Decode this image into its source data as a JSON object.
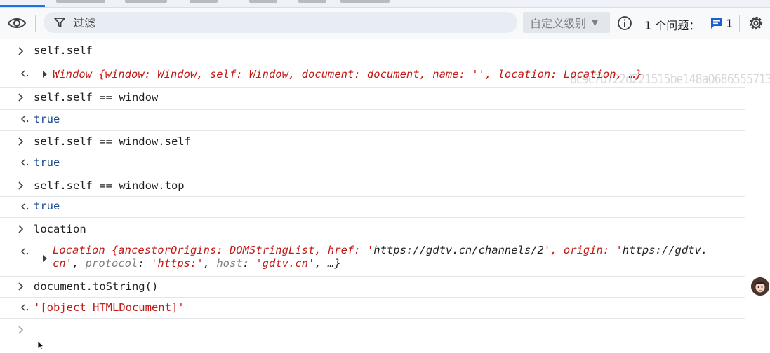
{
  "toolbar": {
    "filter_placeholder": "过滤",
    "levels_label": "自定义级别",
    "issues_label": "1 个问题：",
    "issues_count": "1"
  },
  "watermark": "8c9c7b722d221515be148a0686555713",
  "console": {
    "entries": [
      {
        "kind": "input",
        "text": "self.self"
      },
      {
        "kind": "output-object",
        "text": "Window {window: Window, self: Window, document: document, name: '', location: Location, …}"
      },
      {
        "kind": "input",
        "text": "self.self == window"
      },
      {
        "kind": "output",
        "text": "true"
      },
      {
        "kind": "input",
        "text": "self.self == window.self"
      },
      {
        "kind": "output",
        "text": "true"
      },
      {
        "kind": "input",
        "text": "self.self == window.top"
      },
      {
        "kind": "output",
        "text": "true"
      },
      {
        "kind": "input",
        "text": "location"
      },
      {
        "kind": "output-object",
        "line1": "Location {ancestorOrigins: DOMStringList, href: 'https://gdtv.cn/channels/2', origin: 'https://gdtv.",
        "line2": "cn', protocol: 'https:', host: 'gdtv.cn', …}"
      },
      {
        "kind": "input",
        "text": "document.toString()"
      },
      {
        "kind": "output",
        "text": "'[object HTMLDocument]'"
      }
    ]
  },
  "colors": {
    "accent": "#1a73e8",
    "string": "#c41a16",
    "boolean": "#1a4b8c",
    "object_key": "#7c7f86",
    "document_value": "#80144f"
  },
  "icons": [
    "eye-icon",
    "filter-icon",
    "chevron-down-icon",
    "info-icon",
    "message-icon",
    "gear-icon",
    "prompt-chevron-icon",
    "result-arrow-icon",
    "expand-triangle-icon",
    "cursor-icon"
  ]
}
